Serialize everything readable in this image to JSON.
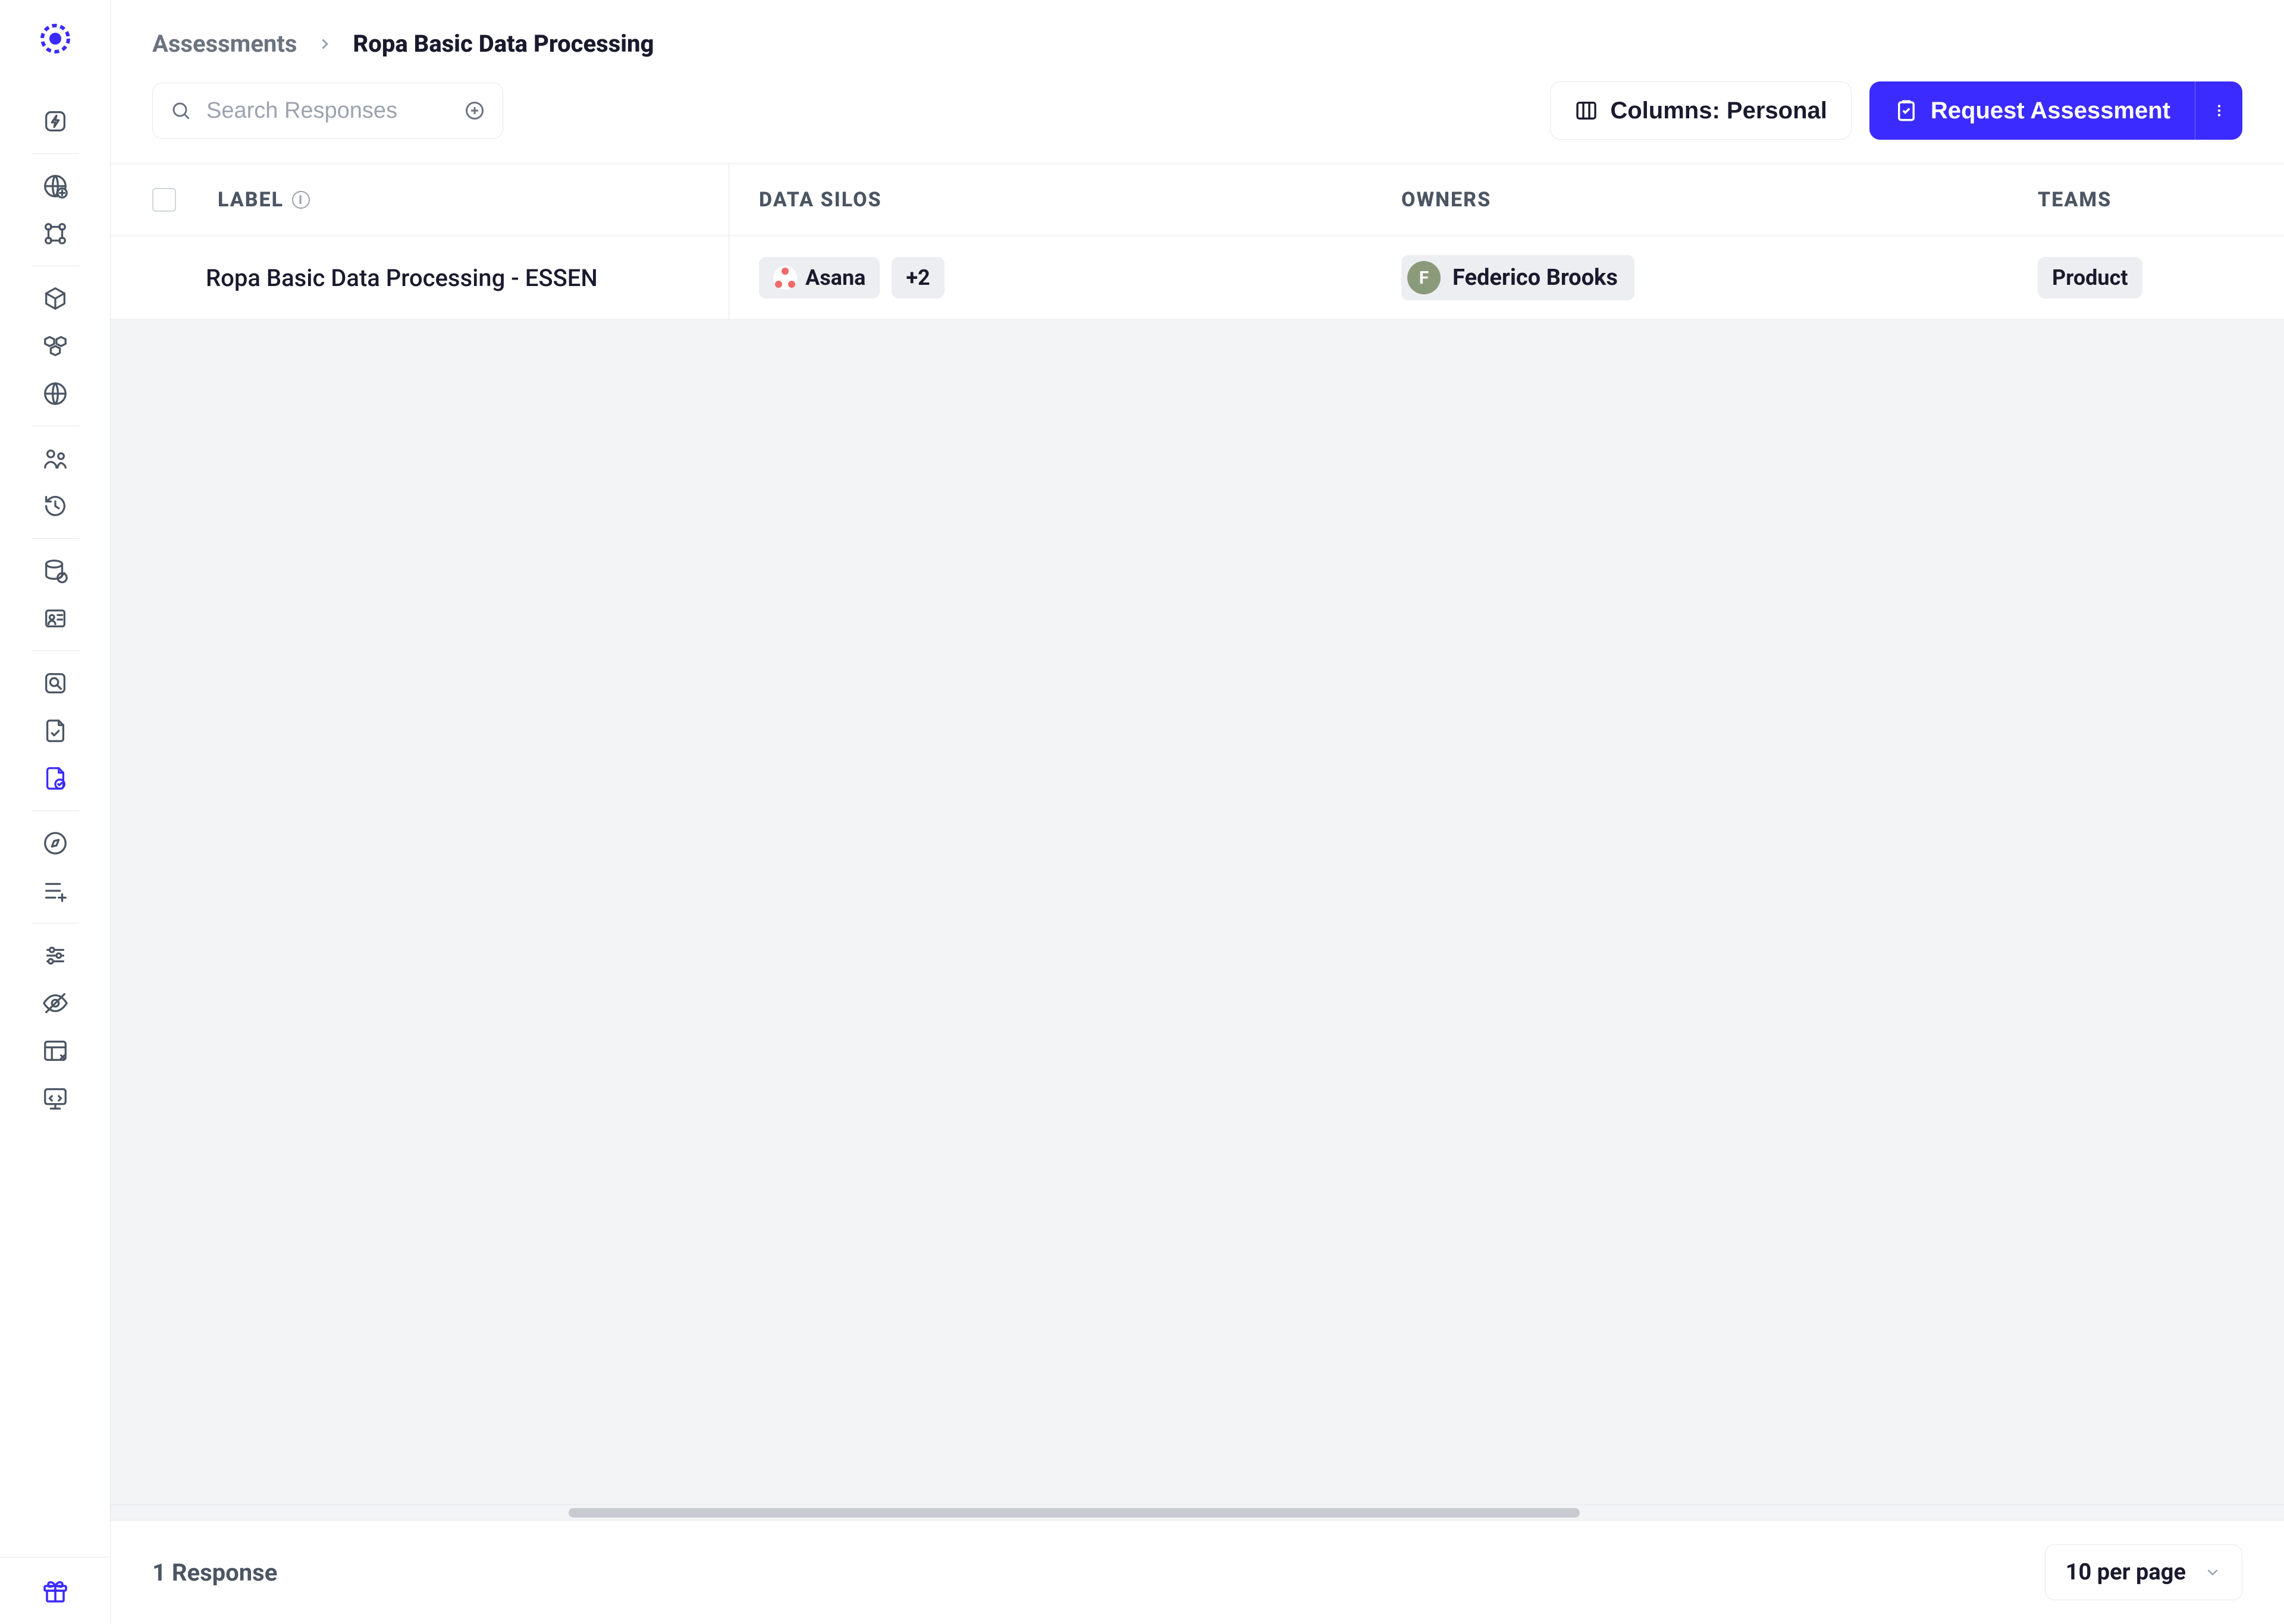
{
  "breadcrumb": {
    "root": "Assessments",
    "current": "Ropa Basic Data Processing"
  },
  "search": {
    "placeholder": "Search Responses"
  },
  "toolbar": {
    "columns_label_prefix": "Columns: ",
    "columns_value": "Personal",
    "request_label": "Request Assessment"
  },
  "table": {
    "headers": {
      "label": "LABEL",
      "data_silos": "DATA SILOS",
      "owners": "OWNERS",
      "teams": "TEAMS"
    },
    "rows": [
      {
        "label": "Ropa Basic Data Processing  - ESSEN",
        "data_silos": {
          "primary": "Asana",
          "more": "+2"
        },
        "owners": [
          {
            "initial": "F",
            "name": "Federico Brooks"
          }
        ],
        "teams": [
          "Product"
        ]
      }
    ]
  },
  "footer": {
    "count": "1 Response",
    "per_page": "10 per page"
  },
  "sidebar": {
    "groups": [
      [
        "bolt-icon"
      ],
      [
        "globe-icon",
        "nodes-icon"
      ],
      [
        "cube-icon",
        "cubes-icon",
        "globe2-icon"
      ],
      [
        "people-icon",
        "history-icon"
      ],
      [
        "database-icon",
        "id-card-icon"
      ],
      [
        "search-db-icon",
        "file-check-icon",
        "file-edit-icon"
      ],
      [
        "compass-icon",
        "list-add-icon"
      ],
      [
        "sliders-icon",
        "eye-off-icon",
        "layout-icon",
        "code-monitor-icon"
      ]
    ],
    "active": "file-edit-icon",
    "bottom": "gift-icon"
  }
}
